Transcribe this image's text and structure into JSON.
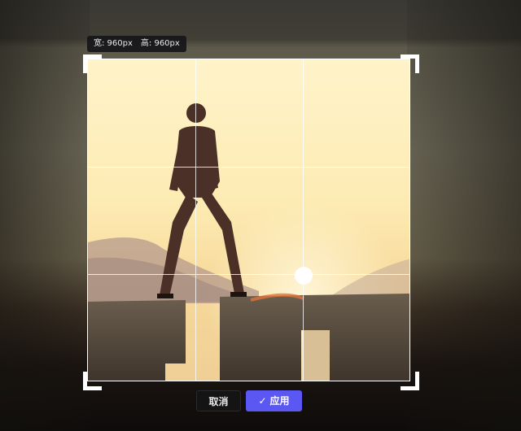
{
  "size_badge": {
    "width_text": "宽: 960px",
    "height_text": "高: 960px"
  },
  "actions": {
    "cancel_label": "取消",
    "apply_label": "应用",
    "apply_icon": "check-icon"
  },
  "colors": {
    "apply_button": "#5b57f2",
    "cancel_button": "#141414",
    "crop_border": "#ffffff"
  }
}
